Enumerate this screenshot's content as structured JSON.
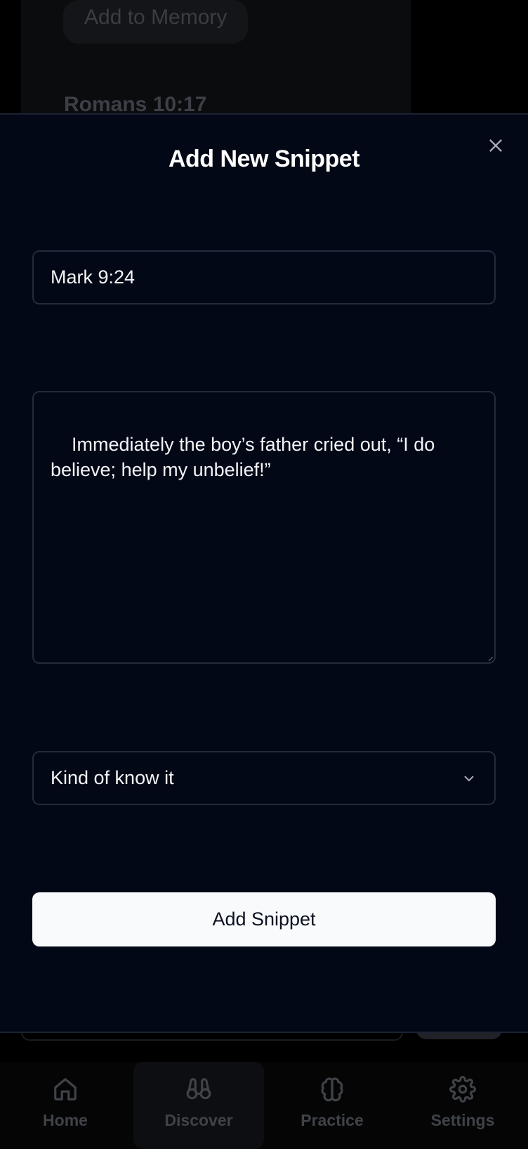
{
  "background": {
    "add_to_memory_label": "Add to Memory",
    "verse_title": "Romans 10:17"
  },
  "modal": {
    "title": "Add New Snippet",
    "close_icon": "close-icon",
    "reference_value": "Mark 9:24",
    "verse_text": "Immediately the boy’s father cried out, “I do believe; help my unbelief!”",
    "familiarity_value": "Kind of know it",
    "submit_label": "Add Snippet"
  },
  "nav": {
    "items": [
      {
        "label": "Home",
        "icon": "home-icon"
      },
      {
        "label": "Discover",
        "icon": "binoculars-icon",
        "active": true
      },
      {
        "label": "Practice",
        "icon": "brain-icon"
      },
      {
        "label": "Settings",
        "icon": "gear-icon"
      }
    ]
  },
  "colors": {
    "modal_bg": "#030816",
    "field_border": "#232b3c",
    "button_bg": "#f8fafc",
    "button_text": "#0b1120"
  }
}
